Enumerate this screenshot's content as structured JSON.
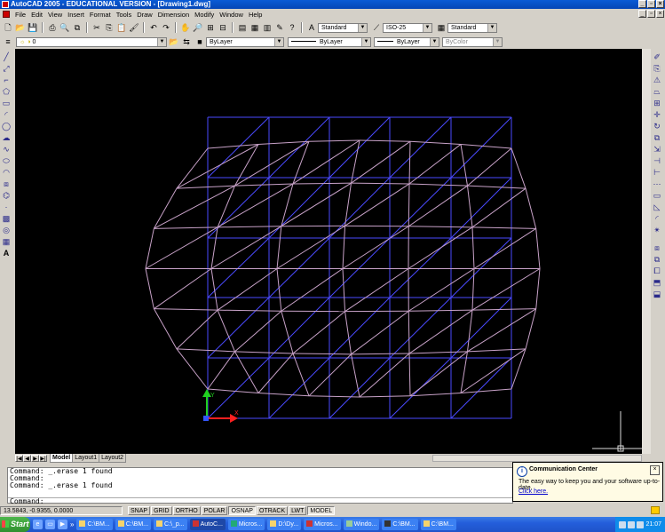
{
  "window": {
    "title": "AutoCAD 2005 - EDUCATIONAL VERSION - [Drawing1.dwg]"
  },
  "menu": [
    "File",
    "Edit",
    "View",
    "Insert",
    "Format",
    "Tools",
    "Draw",
    "Dimension",
    "Modify",
    "Window",
    "Help"
  ],
  "styles": {
    "text_style": "Standard",
    "dim_style": "ISO-25",
    "table_style": "Standard"
  },
  "layers": {
    "current_layer": "0",
    "color": "ByLayer",
    "linetype": "ByLayer",
    "lineweight": "ByLayer",
    "plot_style": "ByColor"
  },
  "tabs": [
    "Model",
    "Layout1",
    "Layout2"
  ],
  "active_tab": "Model",
  "command": {
    "lines": [
      "Command: _.erase 1 found",
      "Command:",
      "Command: _.erase 1 found"
    ],
    "prompt": "Command:"
  },
  "comm_center": {
    "title": "Communication Center",
    "message": "The easy way to keep you and your software up-to-date.",
    "link": "Click here."
  },
  "status": {
    "coords": "13.5843, -0.9355, 0.0000",
    "toggles": [
      "SNAP",
      "GRID",
      "ORTHO",
      "POLAR",
      "OSNAP",
      "OTRACK",
      "LWT",
      "MODEL"
    ],
    "active": [
      "OSNAP",
      "MODEL"
    ]
  },
  "taskbar": {
    "start": "Start",
    "tasks": [
      "C:\\BM...",
      "C:\\BM...",
      "C:\\_p...",
      "AutoC...",
      "Micros...",
      "D:\\Dy...",
      "Micros...",
      "Windo...",
      "C:\\BM...",
      "C:\\BM..."
    ],
    "active_task": "AutoC...",
    "time": "21:07"
  },
  "colors": {
    "grid": "#4a4aff",
    "mesh": "#c8a2c8",
    "ucs_x": "#ff2020",
    "ucs_y": "#20d020",
    "background": "#000000"
  },
  "ucs": {
    "x_label": "X",
    "y_label": "Y"
  }
}
